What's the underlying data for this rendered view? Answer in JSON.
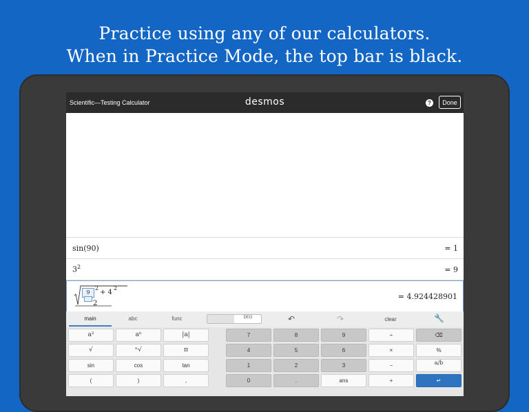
{
  "headline": {
    "line1": "Practice using any of our calculators.",
    "line2": "When in Practice Mode, the top bar is black."
  },
  "topbar": {
    "calculator_name": "Scientific—Testing Calculator",
    "brand": "desmos",
    "help_icon": "?",
    "done_label": "Done"
  },
  "expressions": [
    {
      "lhs": "sin(90)",
      "rhs": "= 1"
    },
    {
      "lhs_base": "3",
      "lhs_exp": "2",
      "rhs": "= 9"
    },
    {
      "frac_num": "9",
      "exp1": "2",
      "plus": "+ 4",
      "exp2": "2",
      "den": "2",
      "rhs": "= 4.924428901"
    }
  ],
  "keypad": {
    "tabs": [
      "main",
      "abc",
      "func"
    ],
    "active_tab": "main",
    "angle_toggle": {
      "left": "",
      "right": "DEG"
    },
    "undo_icon": "undo-icon",
    "redo_icon": "redo-icon",
    "clear_label": "clear",
    "settings_icon": "wrench-icon",
    "rows": [
      [
        "a²",
        "aᵇ",
        "|a|",
        "7",
        "8",
        "9",
        "÷",
        "⌫"
      ],
      [
        "√",
        "ⁿ√",
        "π",
        "4",
        "5",
        "6",
        "×",
        "%"
      ],
      [
        "sin",
        "cos",
        "tan",
        "1",
        "2",
        "3",
        "−",
        "a/b"
      ],
      [
        "(",
        ")",
        ",",
        "0",
        ".",
        "ans",
        "+",
        "↵"
      ]
    ]
  },
  "colors": {
    "background": "#1466c4",
    "tablet": "#3a3a3a",
    "topbar": "#2b2b2b",
    "enter_key": "#2f74c0"
  }
}
